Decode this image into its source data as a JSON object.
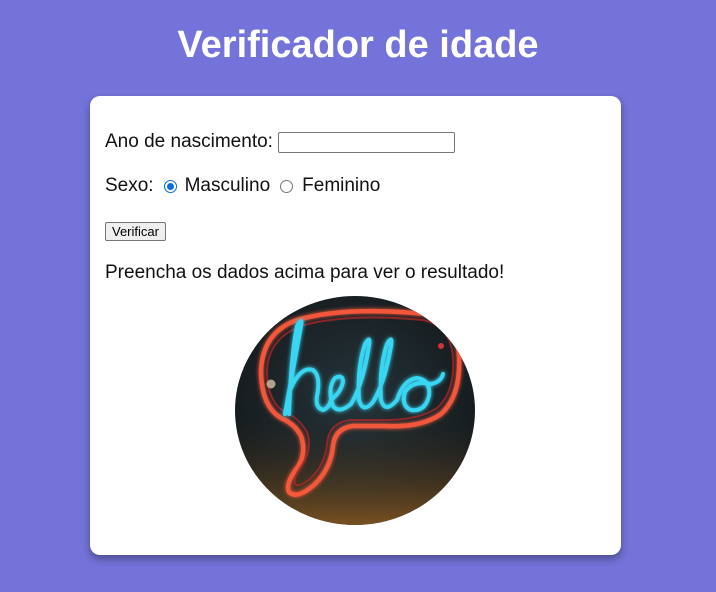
{
  "header": {
    "title": "Verificador de idade"
  },
  "form": {
    "year_label": "Ano de nascimento:",
    "year_value": "",
    "sex_label": "Sexo:",
    "sex_options": [
      {
        "label": "Masculino",
        "checked": true
      },
      {
        "label": "Feminino",
        "checked": false
      }
    ],
    "verify_label": "Verificar"
  },
  "result": {
    "text": "Preencha os dados acima para ver o resultado!"
  },
  "image": {
    "neon_text": "hello"
  },
  "colors": {
    "background": "#7373d9",
    "card": "#ffffff",
    "accent": "#0b6fd6",
    "neon_text": "#39d6f2",
    "neon_outline": "#ff5a3c"
  }
}
